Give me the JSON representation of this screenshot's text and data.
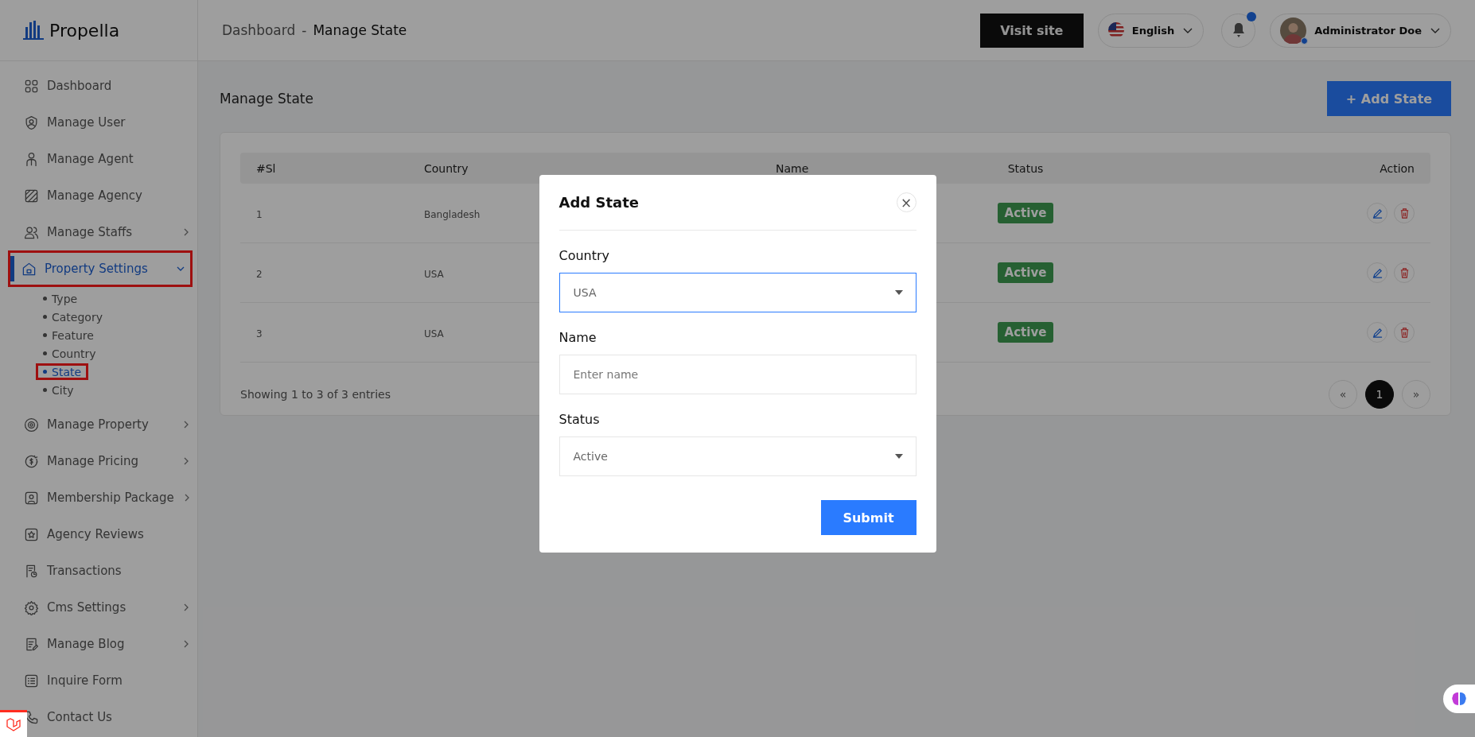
{
  "sidebar": {
    "logo": "Propella",
    "items": [
      {
        "label": "Dashboard",
        "selected": false,
        "highlighted": false
      },
      {
        "label": "Manage User",
        "selected": false,
        "highlighted": false
      },
      {
        "label": "Manage Agent",
        "selected": false,
        "highlighted": false
      },
      {
        "label": "Manage Agency",
        "selected": false,
        "highlighted": false
      },
      {
        "label": "Manage Staffs",
        "expanded": false,
        "selected": false,
        "highlighted": false
      },
      {
        "label": "Property Settings",
        "expanded": true,
        "selected": true,
        "highlighted": true,
        "children": [
          {
            "label": "Type",
            "selected": false,
            "highlighted": false
          },
          {
            "label": "Category",
            "selected": false,
            "highlighted": false
          },
          {
            "label": "Feature",
            "selected": false,
            "highlighted": false
          },
          {
            "label": "Country",
            "selected": false,
            "highlighted": false
          },
          {
            "label": "State",
            "selected": true,
            "highlighted": true
          },
          {
            "label": "City",
            "selected": false,
            "highlighted": false
          }
        ]
      },
      {
        "label": "Manage Property",
        "expanded": false,
        "selected": false,
        "highlighted": false
      },
      {
        "label": "Manage Pricing",
        "expanded": false,
        "selected": false,
        "highlighted": false
      },
      {
        "label": "Membership Package",
        "expanded": false,
        "selected": false,
        "highlighted": false
      },
      {
        "label": "Agency Reviews",
        "selected": false,
        "highlighted": false
      },
      {
        "label": "Transactions",
        "selected": false,
        "highlighted": false
      },
      {
        "label": "Cms Settings",
        "expanded": false,
        "selected": false,
        "highlighted": false
      },
      {
        "label": "Manage Blog",
        "expanded": false,
        "selected": false,
        "highlighted": false
      },
      {
        "label": "Inquire Form",
        "selected": false,
        "highlighted": false
      },
      {
        "label": "Contact Us",
        "selected": false,
        "highlighted": false
      }
    ]
  },
  "header": {
    "breadcrumb": [
      "Dashboard",
      "-",
      "Manage State"
    ],
    "visit_button": "Visit site",
    "language": "English",
    "notifications_unread": true,
    "user": {
      "name": "Administrator Doe",
      "online": true
    }
  },
  "page": {
    "title": "Manage State",
    "add_button": "+ Add State"
  },
  "table": {
    "columns": [
      "#Sl",
      "Country",
      "Name",
      "Status",
      "Action"
    ],
    "rows": [
      {
        "sl": "1",
        "country": "Bangladesh",
        "status": "Active"
      },
      {
        "sl": "2",
        "country": "USA",
        "status": "Active"
      },
      {
        "sl": "3",
        "country": "USA",
        "status": "Active"
      }
    ],
    "footer": "Showing 1 to 3 of 3 entries",
    "pagination": [
      {
        "label": "«",
        "selected": false
      },
      {
        "label": "1",
        "selected": true
      },
      {
        "label": "»",
        "selected": false
      }
    ]
  },
  "modal": {
    "title": "Add State",
    "close": "×",
    "fields": [
      {
        "label": "Country",
        "kind": "select",
        "value": "USA",
        "focused": true
      },
      {
        "label": "Name",
        "kind": "text",
        "placeholder": "Enter name",
        "focused": false
      },
      {
        "label": "Status",
        "kind": "select",
        "value": "Active",
        "focused": false
      }
    ],
    "submit": "Submit"
  }
}
